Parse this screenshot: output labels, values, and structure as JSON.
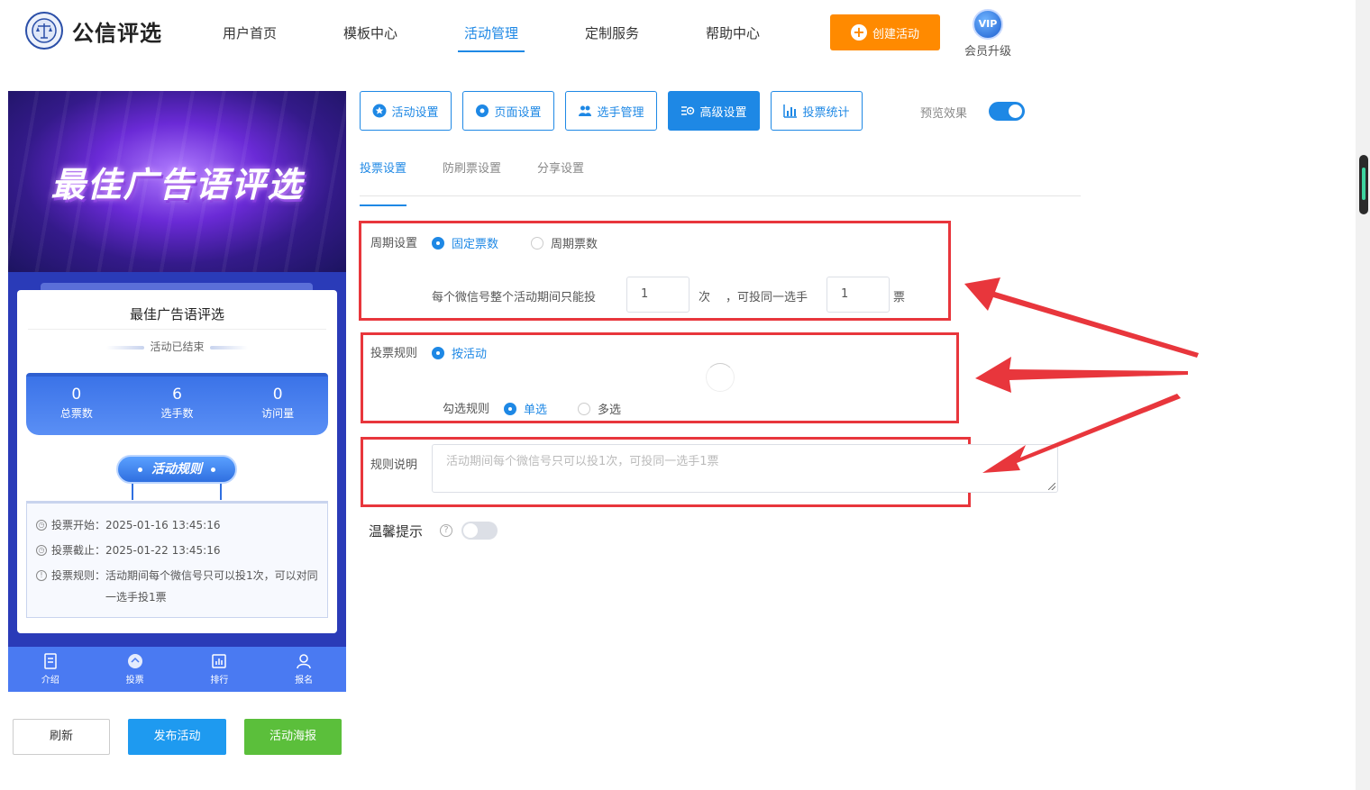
{
  "header": {
    "logo_text": "公信评选",
    "nav": [
      "用户首页",
      "模板中心",
      "活动管理",
      "定制服务",
      "帮助中心"
    ],
    "create_button": "创建活动",
    "vip_badge": "VIP",
    "vip_label": "会员升级"
  },
  "preview": {
    "banner_title": "最佳广告语评选",
    "card_title": "最佳广告语评选",
    "status": "活动已结束",
    "stats": [
      {
        "num": "0",
        "label": "总票数"
      },
      {
        "num": "6",
        "label": "选手数"
      },
      {
        "num": "0",
        "label": "访问量"
      }
    ],
    "rule_pill": "活动规则",
    "rules": [
      {
        "label": "投票开始：",
        "value": "2025-01-16 13:45:16"
      },
      {
        "label": "投票截止：",
        "value": "2025-01-22 13:45:16"
      },
      {
        "label": "投票规则：",
        "value": "活动期间每个微信号只可以投1次，可以对同一选手投1票"
      }
    ],
    "tabbar": [
      "介绍",
      "投票",
      "排行",
      "报名"
    ]
  },
  "bottom_buttons": {
    "refresh": "刷新",
    "publish": "发布活动",
    "poster": "活动海报"
  },
  "tools": [
    "活动设置",
    "页面设置",
    "选手管理",
    "高级设置",
    "投票统计"
  ],
  "preview_toggle_label": "预览效果",
  "subtabs": [
    "投票设置",
    "防刷票设置",
    "分享设置"
  ],
  "form": {
    "period_label": "周期设置",
    "period_options": [
      "固定票数",
      "周期票数"
    ],
    "limit_text_1": "每个微信号整个活动期间只能投",
    "limit_value_1": "1",
    "limit_unit_1": "次",
    "limit_text_2": "，可投同一选手",
    "limit_value_2": "1",
    "limit_unit_2": "票",
    "rule_label": "投票规则",
    "rule_option": "按活动",
    "check_rule_label": "勾选规则",
    "check_options": [
      "单选",
      "多选"
    ],
    "desc_label": "规则说明",
    "desc_placeholder": "活动期间每个微信号只可以投1次，可投同一选手1票",
    "tip_label": "温馨提示",
    "help": "?"
  },
  "colors": {
    "accent": "#1e88e5",
    "orange": "#ff8a00",
    "green": "#5bbf3b",
    "annotation_red": "#e8363c"
  }
}
